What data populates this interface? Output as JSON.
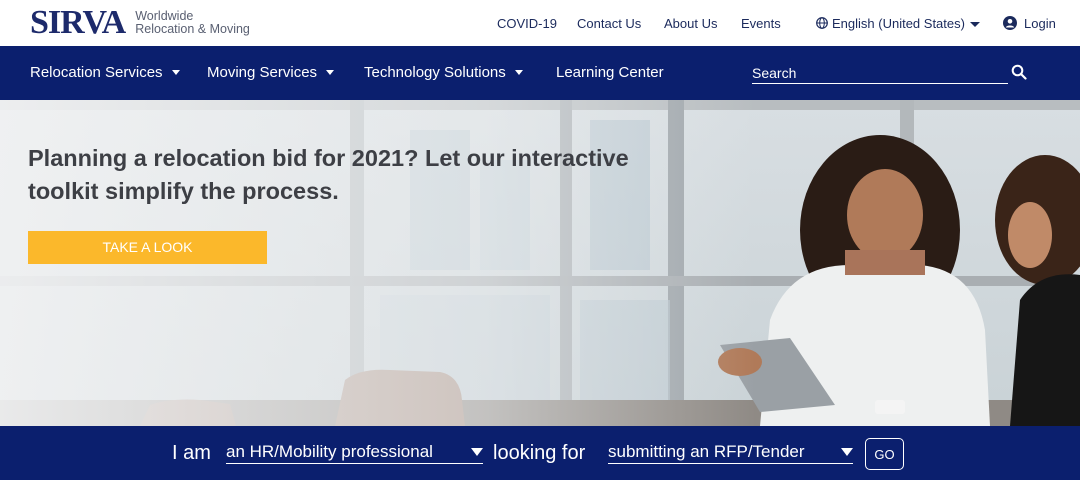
{
  "brand": {
    "name": "SIRVA",
    "tagline_line1": "Worldwide",
    "tagline_line2": "Relocation & Moving"
  },
  "utility_nav": {
    "covid": "COVID-19",
    "contact": "Contact Us",
    "about": "About Us",
    "events": "Events",
    "language": "English (United States)",
    "login": "Login"
  },
  "main_nav": {
    "relocation": "Relocation Services",
    "moving": "Moving Services",
    "technology": "Technology Solutions",
    "learning": "Learning Center",
    "search_placeholder": "Search"
  },
  "hero": {
    "title": "Planning a relocation bid for 2021? Let our interactive toolkit simplify the process.",
    "cta_label": "TAKE A LOOK"
  },
  "selector": {
    "i_am_label": "I am",
    "role_value": "an HR/Mobility professional",
    "looking_for_label": "looking for",
    "purpose_value": "submitting an RFP/Tender",
    "go_label": "GO"
  },
  "colors": {
    "navy": "#0b1f6e",
    "cta_yellow": "#fbb82b",
    "logo_blue": "#1d2a6b"
  },
  "icons": {
    "globe": "globe-icon",
    "user": "user-icon",
    "search": "search-icon"
  }
}
